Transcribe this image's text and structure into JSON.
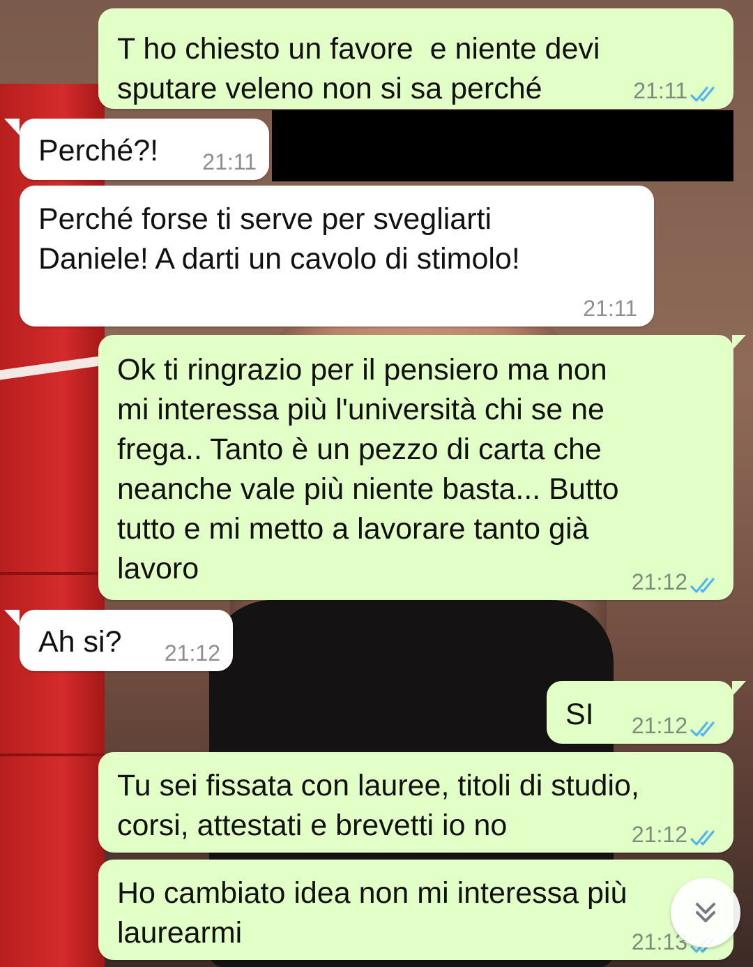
{
  "chat": {
    "messages": [
      {
        "direction": "out",
        "text": "T ho chiesto un favore  e niente devi\nsputare veleno non si sa perché",
        "time": "21:11",
        "status": "read"
      },
      {
        "direction": "in",
        "text": "Perché?!",
        "time": "21:11"
      },
      {
        "direction": "in",
        "text": "Perché forse ti serve per svegliarti\nDaniele! A darti un cavolo di stimolo!",
        "time": "21:11"
      },
      {
        "direction": "out",
        "text": "Ok ti ringrazio per il pensiero ma non\nmi interessa più l'università chi se ne\nfrega.. Tanto è un pezzo di carta che\nneanche vale più niente basta... Butto\ntutto e mi metto a lavorare tanto già\nlavoro",
        "time": "21:12",
        "status": "read"
      },
      {
        "direction": "in",
        "text": "Ah si?",
        "time": "21:12"
      },
      {
        "direction": "out",
        "text": "SI",
        "time": "21:12",
        "status": "read"
      },
      {
        "direction": "out",
        "text": "Tu sei fissata con lauree, titoli di studio,\ncorsi, attestati e brevetti io no",
        "time": "21:12",
        "status": "read"
      },
      {
        "direction": "out",
        "text": "Ho cambiato idea non mi interessa più\nlaurearmi",
        "time": "21:13",
        "status": "read"
      }
    ]
  },
  "colors": {
    "outgoing_bubble": "#e1ffc7",
    "incoming_bubble": "#ffffff",
    "read_ticks": "#4fb6ec"
  },
  "icons": {
    "read_receipt": "double-check-icon",
    "scroll_down": "double-chevron-down-icon"
  }
}
